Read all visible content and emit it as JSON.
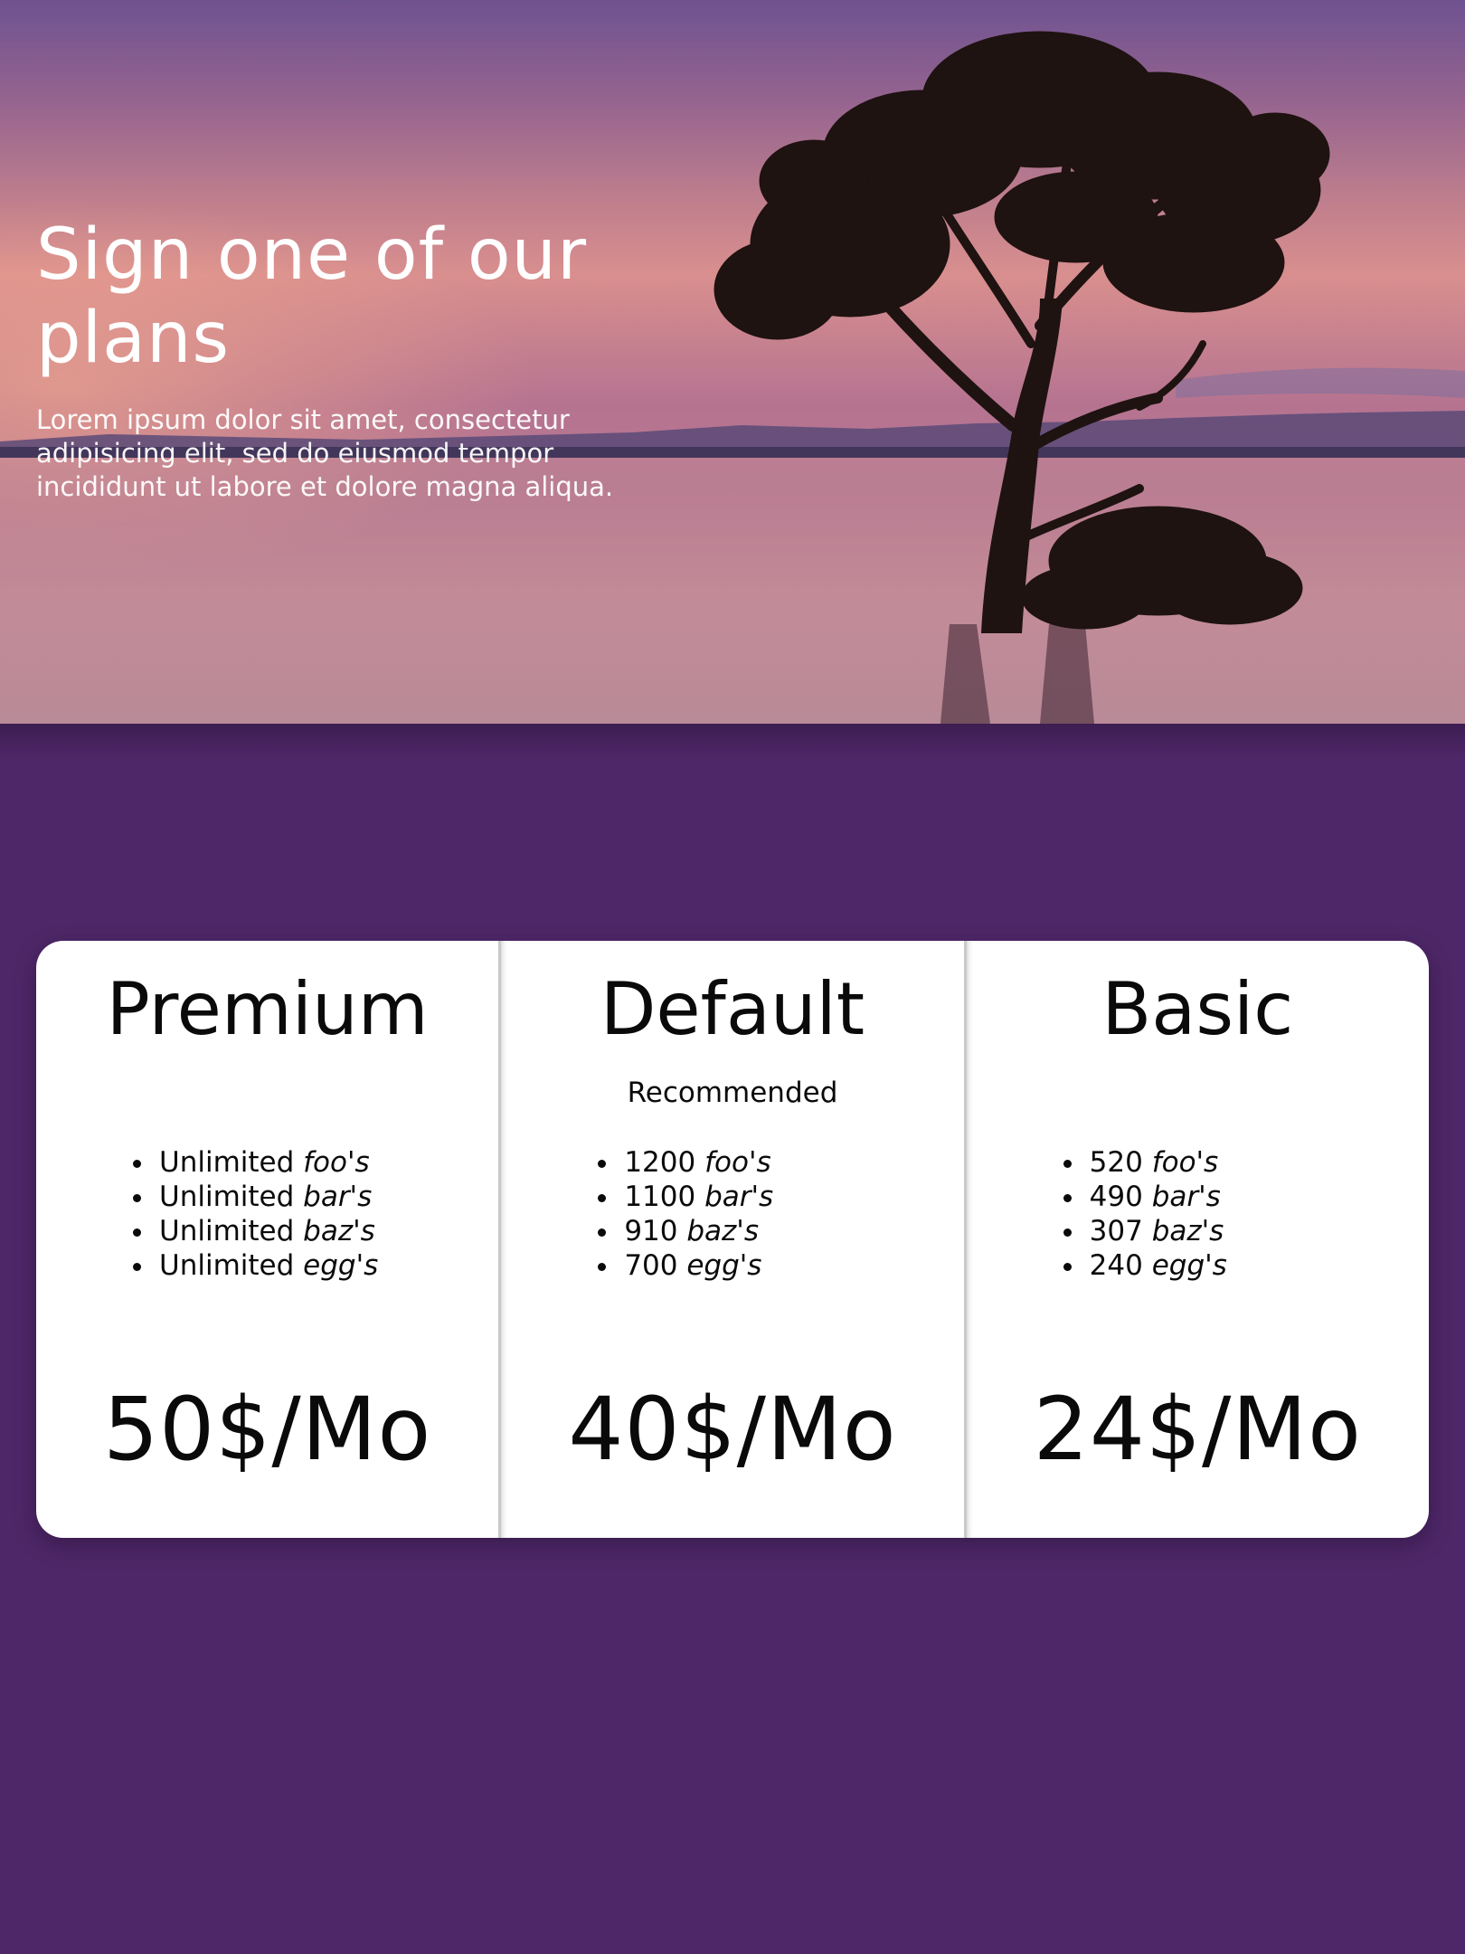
{
  "hero": {
    "title_line1": "Sign one of our",
    "title_line2": "plans",
    "description": "Lorem ipsum dolor sit amet, consectetur adipisicing elit, sed do eiusmod tempor incididunt ut labore et dolore magna aliqua."
  },
  "plans": [
    {
      "name": "Premium",
      "tag": "",
      "features": [
        {
          "prefix": "Unlimited",
          "item": "foo's"
        },
        {
          "prefix": "Unlimited",
          "item": "bar's"
        },
        {
          "prefix": "Unlimited",
          "item": "baz's"
        },
        {
          "prefix": "Unlimited",
          "item": "egg's"
        }
      ],
      "price": "50$/Mo"
    },
    {
      "name": "Default",
      "tag": "Recommended",
      "features": [
        {
          "prefix": "1200",
          "item": "foo's"
        },
        {
          "prefix": "1100",
          "item": "bar's"
        },
        {
          "prefix": "910",
          "item": "baz's"
        },
        {
          "prefix": "700",
          "item": "egg's"
        }
      ],
      "price": "40$/Mo"
    },
    {
      "name": "Basic",
      "tag": "",
      "features": [
        {
          "prefix": "520",
          "item": "foo's"
        },
        {
          "prefix": "490",
          "item": "bar's"
        },
        {
          "prefix": "307",
          "item": "baz's"
        },
        {
          "prefix": "240",
          "item": "egg's"
        }
      ],
      "price": "24$/Mo"
    }
  ],
  "colors": {
    "page_background": "#4e2768",
    "card_background": "#ffffff",
    "text_dark": "#0a0a0a",
    "hero_text": "#ffffff"
  }
}
